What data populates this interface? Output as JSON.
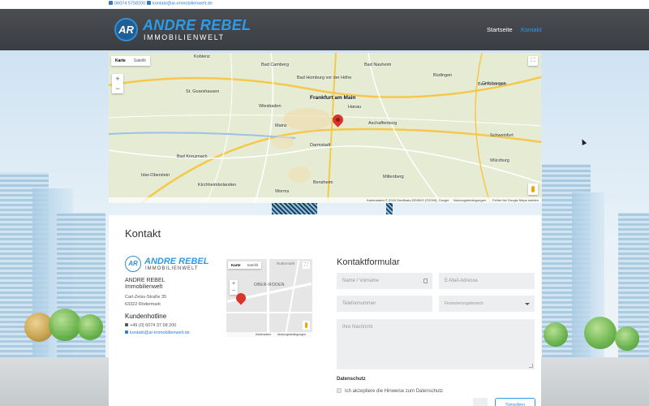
{
  "topbar": {
    "phone": "06074 5758200",
    "email": "kontakt@ar-immobilienwelt.de"
  },
  "brand": {
    "initials": "AR",
    "name": "ANDRE REBEL",
    "tagline": "IMMOBILIENWELT",
    "color": "#2e9be6"
  },
  "nav": {
    "home": "Startseite",
    "contact": "Kontakt"
  },
  "map": {
    "type_map": "Karte",
    "type_satellite": "Satellit",
    "zoom_in": "+",
    "zoom_out": "−",
    "cities": [
      "Koblenz",
      "Bad Camberg",
      "Bad Nauheim",
      "Büdingen",
      "Gelnhausen",
      "Bad Kissingen",
      "Wiesbaden",
      "Frankfurt am Main",
      "Hanau",
      "Aschaffenburg",
      "Schweinfurt",
      "Mainz",
      "Darmstadt",
      "Bad Kreuznach",
      "Worms",
      "Würzburg",
      "Idar-Oberstein",
      "Bensheim",
      "Miltenberg",
      "Kirchheimbolanden",
      "St. Goarshausen",
      "Bad Homburg vor der Höhe"
    ],
    "footer_data": "Kartendaten © 2018 GeoBasis-DE/BKG (©2009), Google",
    "footer_terms": "Nutzungsbedingungen",
    "footer_report": "Fehler bei Google Maps melden"
  },
  "contact": {
    "title": "Kontakt",
    "company_line1": "ANDRE REBEL",
    "company_line2": "Immobilienwelt",
    "street": "Carl-Zeiss-Straße 35",
    "city": "63322 Rödermark",
    "hotline_heading": "Kundenhotline",
    "phone": "+49 (0) 6074 37 08 200",
    "email": "kontakt@ar-immobilienwelt.de"
  },
  "small_map": {
    "type_map": "Karte",
    "type_satellite": "Satellit",
    "area_label": "OBER-RODEN",
    "top_label": "Rodermark",
    "footer_data": "Kartendaten",
    "footer_terms": "Nutzungsbedingungen"
  },
  "form": {
    "title": "Kontaktformular",
    "name_placeholder": "Name / Vorname",
    "email_placeholder": "E-Mail-Adresse",
    "phone_placeholder": "Telefonnummer",
    "financing_placeholder": "Finanzierungsbereich",
    "message_placeholder": "Ihre Nachricht",
    "privacy_label": "Datenschutz",
    "privacy_checkbox": "Ich akzeptiere die Hinweise zum Datenschutz",
    "send_label": "Senden"
  }
}
